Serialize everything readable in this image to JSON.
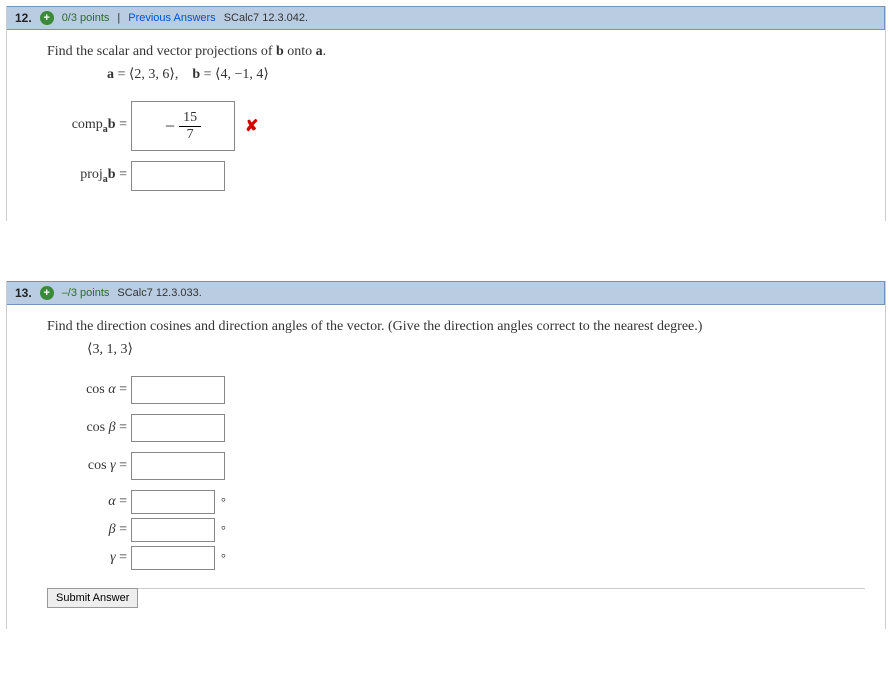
{
  "q12": {
    "number": "12.",
    "points": "0/3 points",
    "prev": "Previous Answers",
    "ref": "SCalc7 12.3.042.",
    "prompt_pre": "Find the scalar and vector projections of ",
    "prompt_b": "b",
    "prompt_mid": " onto ",
    "prompt_a": "a",
    "prompt_end": ".",
    "vec_a_lbl": "a",
    "vec_a_val": " = ⟨2, 3, 6⟩,",
    "vec_b_lbl": "b",
    "vec_b_val": " = ⟨4, −1, 4⟩",
    "comp_label_pre": "comp",
    "comp_label_sub": "a",
    "comp_label_b": "b",
    "eq": " =",
    "comp_sign": "−",
    "comp_num": "15",
    "comp_den": "7",
    "proj_label_pre": "proj",
    "proj_label_sub": "a",
    "proj_label_b": "b"
  },
  "q13": {
    "number": "13.",
    "points": "–/3 points",
    "ref": "SCalc7 12.3.033.",
    "prompt": "Find the direction cosines and direction angles of the vector. (Give the direction angles correct to the nearest degree.)",
    "vector": "⟨3, 1, 3⟩",
    "cos": "cos ",
    "alpha": "α",
    "beta": "β",
    "gamma": "γ",
    "eq": " =",
    "deg": "°",
    "submit": "Submit Answer"
  },
  "sep": "|"
}
